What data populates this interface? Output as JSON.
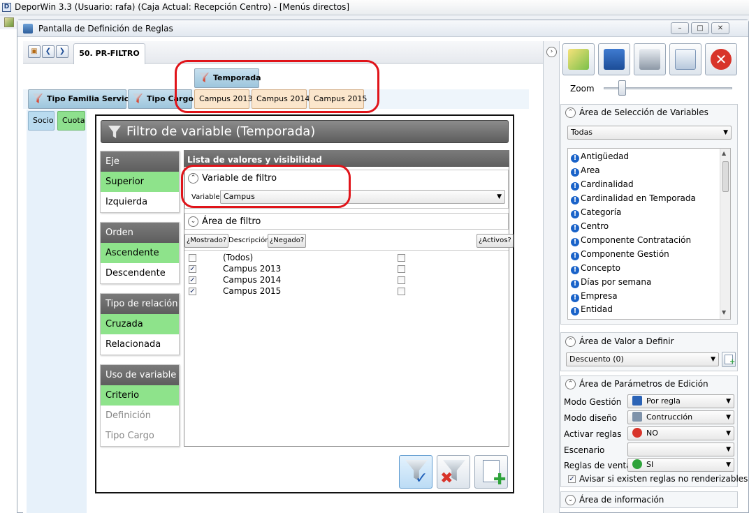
{
  "app": {
    "outer_title": "DeporWin 3.3  (Usuario: rafa)  (Caja Actual: Recepción Centro) - [Menús directos]",
    "outer_icon_letter": "D",
    "inner_title": "Pantalla de Definición de Reglas"
  },
  "tabs": {
    "active_label": "50. PR-FILTRO"
  },
  "chips": {
    "temporada": "Temporada",
    "tipo_familia": "Tipo Familia Servicio",
    "tipo_cargo": "Tipo Cargo",
    "campus_2013": "Campus 2013",
    "campus_2014": "Campus 2014",
    "campus_2015": "Campus 2015",
    "socio": "Socio",
    "cuota": "Cuota"
  },
  "dialog": {
    "title": "Filtro de variable (Temporada)",
    "groups": [
      {
        "header": "Eje",
        "options": [
          {
            "label": "Superior",
            "state": "selected"
          },
          {
            "label": "Izquierda",
            "state": "normal"
          }
        ]
      },
      {
        "header": "Orden",
        "options": [
          {
            "label": "Ascendente",
            "state": "selected"
          },
          {
            "label": "Descendente",
            "state": "normal"
          }
        ]
      },
      {
        "header": "Tipo de relación",
        "options": [
          {
            "label": "Cruzada",
            "state": "selected"
          },
          {
            "label": "Relacionada",
            "state": "normal"
          }
        ]
      },
      {
        "header": "Uso de variable",
        "options": [
          {
            "label": "Criterio",
            "state": "selected"
          },
          {
            "label": "Definición",
            "state": "disabled"
          },
          {
            "label": "Tipo Cargo",
            "state": "disabled"
          }
        ]
      }
    ],
    "list_header": "Lista de valores y visibilidad",
    "variable_filtro": {
      "title": "Variable de filtro",
      "label": "Variable",
      "value": "Campus"
    },
    "area_filtro": {
      "title": "Área de filtro"
    },
    "grid_buttons": {
      "mostrado": "¿Mostrado?",
      "descripcion": "Descripción",
      "negado": "¿Negado?",
      "activos": "¿Activos?"
    },
    "rows": [
      {
        "label": "(Todos)",
        "shown": false,
        "negated": false
      },
      {
        "label": "Campus 2013",
        "shown": true,
        "negated": false
      },
      {
        "label": "Campus 2014",
        "shown": true,
        "negated": false
      },
      {
        "label": "Campus 2015",
        "shown": true,
        "negated": false
      }
    ]
  },
  "right": {
    "zoom_label": "Zoom",
    "zoom_level": 0.12,
    "vars_section": {
      "title": "Área de Selección de Variables",
      "filter": "Todas",
      "items": [
        "Antigüedad",
        "Area",
        "Cardinalidad",
        "Cardinalidad en Temporada",
        "Categoría",
        "Centro",
        "Componente Contratación",
        "Componente Gestión",
        "Concepto",
        "Días por semana",
        "Empresa",
        "Entidad"
      ]
    },
    "valor_section": {
      "title": "Área de Valor a Definir",
      "value": "Descuento (0)"
    },
    "params_section": {
      "title": "Área de Parámetros de Edición",
      "rows": [
        {
          "label": "Modo Gestión",
          "value": "Por regla",
          "icon": "book-icon",
          "color": "#2b63b6"
        },
        {
          "label": "Modo diseño",
          "value": "Contrucción",
          "icon": "tools-icon",
          "color": "#7f93aa"
        },
        {
          "label": "Activar reglas",
          "value": "NO",
          "icon": "no-icon",
          "color": "#d8342a"
        },
        {
          "label": "Escenario",
          "value": "",
          "icon": "",
          "color": ""
        },
        {
          "label": "Reglas de venta",
          "value": "SI",
          "icon": "yes-icon",
          "color": "#2ea33a"
        }
      ],
      "checkbox_label": "Avisar si existen reglas no renderizables",
      "checkbox_checked": true
    },
    "info_section": {
      "title": "Área de información"
    }
  }
}
